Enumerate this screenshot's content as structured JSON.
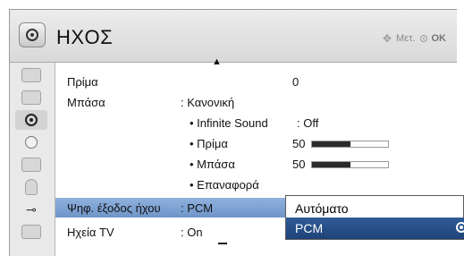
{
  "header": {
    "title": "ΗΧΟΣ",
    "move_hint": "Μετ.",
    "ok_hint": "OK"
  },
  "sidebar": {
    "items": [
      {
        "icon": "satellite-dish-icon"
      },
      {
        "icon": "tv-screen-icon"
      },
      {
        "icon": "audio-icon",
        "active": true
      },
      {
        "icon": "clock-icon"
      },
      {
        "icon": "calendar-icon"
      },
      {
        "icon": "lock-icon"
      },
      {
        "icon": "plug-icon"
      },
      {
        "icon": "bars-icon"
      }
    ]
  },
  "menu": {
    "rows": [
      {
        "label": "Πρίμα",
        "value": "",
        "extra": "0"
      },
      {
        "label": "Μπάσα",
        "value": ": Κανονική",
        "extra": ""
      },
      {
        "label": "",
        "value": "• Infinite Sound",
        "extra": ": Off"
      },
      {
        "label": "",
        "value": "• Πρίμα",
        "extra": "50"
      },
      {
        "label": "",
        "value": "• Μπάσα",
        "extra": "50"
      },
      {
        "label": "",
        "value": "• Επαναφορά",
        "extra": ""
      },
      {
        "label": "Ψηφ. έξοδος ήχου",
        "value": ": PCM",
        "extra": ""
      },
      {
        "label": "Ηχεία TV",
        "value": ": On",
        "extra": ""
      }
    ],
    "treble_level": 0.5,
    "bass_level": 0.5
  },
  "popup": {
    "options": [
      "Αυτόματο",
      "PCM"
    ],
    "selected": "PCM"
  },
  "colors": {
    "selected_row": "#7fa4d6",
    "popup_selected": "#2b5a98"
  }
}
